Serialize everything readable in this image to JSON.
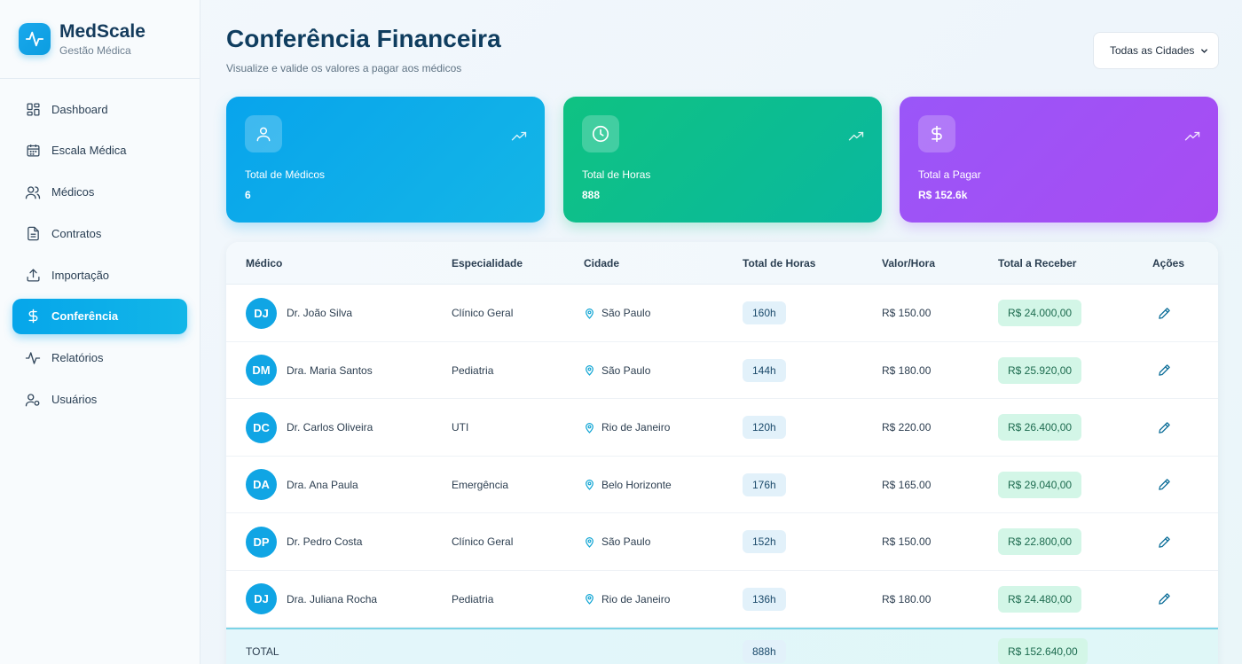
{
  "brand": {
    "name": "MedScale",
    "subtitle": "Gestão Médica"
  },
  "nav": [
    {
      "label": "Dashboard",
      "icon": "grid-icon",
      "active": false
    },
    {
      "label": "Escala Médica",
      "icon": "calendar-icon",
      "active": false
    },
    {
      "label": "Médicos",
      "icon": "users-icon",
      "active": false
    },
    {
      "label": "Contratos",
      "icon": "file-icon",
      "active": false
    },
    {
      "label": "Importação",
      "icon": "upload-icon",
      "active": false
    },
    {
      "label": "Conferência",
      "icon": "dollar-icon",
      "active": true
    },
    {
      "label": "Relatórios",
      "icon": "activity-icon",
      "active": false
    },
    {
      "label": "Usuários",
      "icon": "user-cog-icon",
      "active": false
    }
  ],
  "header": {
    "title": "Conferência Financeira",
    "subtitle": "Visualize e valide os valores a pagar aos médicos",
    "city_filter": "Todas as Cidades"
  },
  "stats": [
    {
      "label": "Total de Médicos",
      "value": "6",
      "icon": "user-icon",
      "color": "#08a4ec"
    },
    {
      "label": "Total de Horas",
      "value": "888",
      "icon": "clock-icon",
      "color": "#0fc282"
    },
    {
      "label": "Total a Pagar",
      "value": "R$ 152.6k",
      "icon": "dollar-icon",
      "color": "#9a56f8"
    }
  ],
  "table": {
    "headers": {
      "medico": "Médico",
      "especialidade": "Especialidade",
      "cidade": "Cidade",
      "horas": "Total de Horas",
      "valor_hora": "Valor/Hora",
      "total": "Total a Receber",
      "acoes": "Ações"
    },
    "rows": [
      {
        "initials": "DJ",
        "name": "Dr. João Silva",
        "specialty": "Clínico Geral",
        "city": "São Paulo",
        "hours": "160h",
        "rate": "R$ 150.00",
        "total": "R$ 24.000,00"
      },
      {
        "initials": "DM",
        "name": "Dra. Maria Santos",
        "specialty": "Pediatria",
        "city": "São Paulo",
        "hours": "144h",
        "rate": "R$ 180.00",
        "total": "R$ 25.920,00"
      },
      {
        "initials": "DC",
        "name": "Dr. Carlos Oliveira",
        "specialty": "UTI",
        "city": "Rio de Janeiro",
        "hours": "120h",
        "rate": "R$ 220.00",
        "total": "R$ 26.400,00"
      },
      {
        "initials": "DA",
        "name": "Dra. Ana Paula",
        "specialty": "Emergência",
        "city": "Belo Horizonte",
        "hours": "176h",
        "rate": "R$ 165.00",
        "total": "R$ 29.040,00"
      },
      {
        "initials": "DP",
        "name": "Dr. Pedro Costa",
        "specialty": "Clínico Geral",
        "city": "São Paulo",
        "hours": "152h",
        "rate": "R$ 150.00",
        "total": "R$ 22.800,00"
      },
      {
        "initials": "DJ",
        "name": "Dra. Juliana Rocha",
        "specialty": "Pediatria",
        "city": "Rio de Janeiro",
        "hours": "136h",
        "rate": "R$ 180.00",
        "total": "R$ 24.480,00"
      }
    ],
    "total_row": {
      "label": "TOTAL",
      "hours": "888h",
      "total": "R$ 152.640,00"
    }
  }
}
